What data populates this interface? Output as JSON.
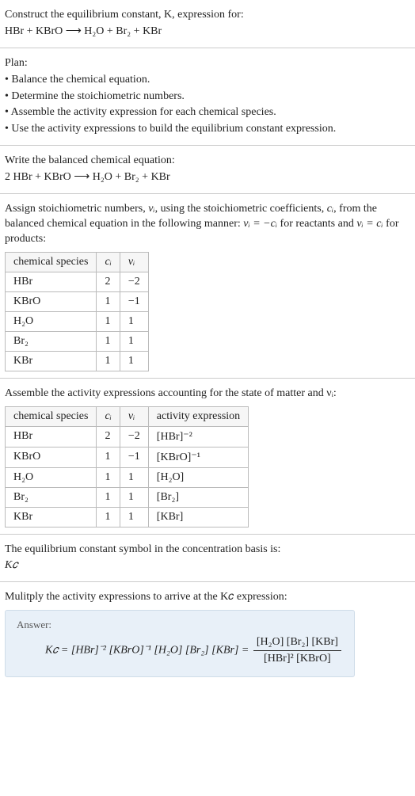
{
  "header": {
    "prompt_line1": "Construct the equilibrium constant, K, expression for:",
    "equation_unbalanced": "HBr + KBrO ⟶ H₂O + Br₂ + KBr"
  },
  "plan": {
    "title": "Plan:",
    "items": [
      "• Balance the chemical equation.",
      "• Determine the stoichiometric numbers.",
      "• Assemble the activity expression for each chemical species.",
      "• Use the activity expressions to build the equilibrium constant expression."
    ]
  },
  "balanced": {
    "title": "Write the balanced chemical equation:",
    "equation": "2 HBr + KBrO ⟶ H₂O + Br₂ + KBr"
  },
  "stoich_intro": {
    "text_part1": "Assign stoichiometric numbers, ",
    "nu_i": "νᵢ",
    "text_part2": ", using the stoichiometric coefficients, ",
    "c_i": "cᵢ",
    "text_part3": ", from the balanced chemical equation in the following manner: ",
    "rule1": "νᵢ = −cᵢ",
    "text_part4": " for reactants and ",
    "rule2": "νᵢ = cᵢ",
    "text_part5": " for products:"
  },
  "table1": {
    "headers": [
      "chemical species",
      "cᵢ",
      "νᵢ"
    ],
    "rows": [
      [
        "HBr",
        "2",
        "−2"
      ],
      [
        "KBrO",
        "1",
        "−1"
      ],
      [
        "H₂O",
        "1",
        "1"
      ],
      [
        "Br₂",
        "1",
        "1"
      ],
      [
        "KBr",
        "1",
        "1"
      ]
    ]
  },
  "activity_intro": "Assemble the activity expressions accounting for the state of matter and νᵢ:",
  "table2": {
    "headers": [
      "chemical species",
      "cᵢ",
      "νᵢ",
      "activity expression"
    ],
    "rows": [
      [
        "HBr",
        "2",
        "−2",
        "[HBr]⁻²"
      ],
      [
        "KBrO",
        "1",
        "−1",
        "[KBrO]⁻¹"
      ],
      [
        "H₂O",
        "1",
        "1",
        "[H₂O]"
      ],
      [
        "Br₂",
        "1",
        "1",
        "[Br₂]"
      ],
      [
        "KBr",
        "1",
        "1",
        "[KBr]"
      ]
    ]
  },
  "kc_basis": {
    "line1": "The equilibrium constant symbol in the concentration basis is:",
    "symbol": "K𝑐"
  },
  "multiply_intro": "Mulitply the activity expressions to arrive at the K𝑐 expression:",
  "answer": {
    "label": "Answer:",
    "lhs": "K𝑐 = [HBr]⁻² [KBrO]⁻¹ [H₂O] [Br₂] [KBr] =",
    "frac_num": "[H₂O] [Br₂] [KBr]",
    "frac_den": "[HBr]² [KBrO]"
  },
  "chart_data": {
    "type": "table",
    "tables": [
      {
        "title": "stoichiometric numbers",
        "columns": [
          "chemical species",
          "c_i",
          "nu_i"
        ],
        "rows": [
          {
            "chemical species": "HBr",
            "c_i": 2,
            "nu_i": -2
          },
          {
            "chemical species": "KBrO",
            "c_i": 1,
            "nu_i": -1
          },
          {
            "chemical species": "H2O",
            "c_i": 1,
            "nu_i": 1
          },
          {
            "chemical species": "Br2",
            "c_i": 1,
            "nu_i": 1
          },
          {
            "chemical species": "KBr",
            "c_i": 1,
            "nu_i": 1
          }
        ]
      },
      {
        "title": "activity expressions",
        "columns": [
          "chemical species",
          "c_i",
          "nu_i",
          "activity expression"
        ],
        "rows": [
          {
            "chemical species": "HBr",
            "c_i": 2,
            "nu_i": -2,
            "activity expression": "[HBr]^-2"
          },
          {
            "chemical species": "KBrO",
            "c_i": 1,
            "nu_i": -1,
            "activity expression": "[KBrO]^-1"
          },
          {
            "chemical species": "H2O",
            "c_i": 1,
            "nu_i": 1,
            "activity expression": "[H2O]"
          },
          {
            "chemical species": "Br2",
            "c_i": 1,
            "nu_i": 1,
            "activity expression": "[Br2]"
          },
          {
            "chemical species": "KBr",
            "c_i": 1,
            "nu_i": 1,
            "activity expression": "[KBr]"
          }
        ]
      }
    ]
  }
}
